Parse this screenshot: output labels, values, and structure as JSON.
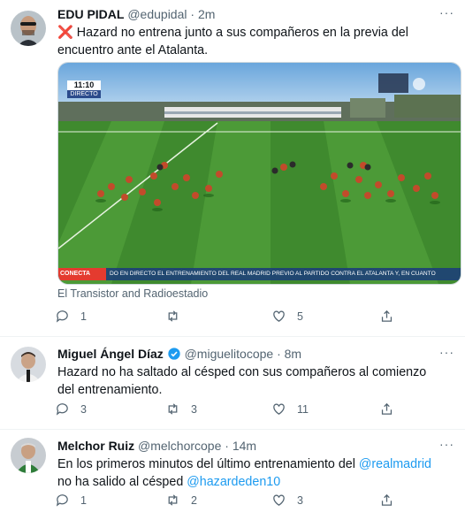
{
  "tweets": [
    {
      "name": "EDU PIDAL",
      "handle": "@edupidal",
      "dot": "·",
      "time": "2m",
      "text_prefix": "❌",
      "text": "Hazard no entrena junto a sus compañeros en la previa del encuentro ante el Atalanta.",
      "media": {
        "overlay_time": "11:10",
        "overlay_live": "DIRECTO",
        "ticker_tag": "CONECTA",
        "ticker": "DO EN DIRECTO EL ENTRENAMIENTO DEL REAL MADRID PREVIO AL PARTIDO CONTRA EL ATALANTA Y, EN CUANTO"
      },
      "source": "El Transistor and Radioestadio",
      "reply_count": "1",
      "retweet_count": "",
      "like_count": "5"
    },
    {
      "name": "Miguel Ángel Díaz",
      "verified": true,
      "handle": "@miguelitocope",
      "dot": "·",
      "time": "8m",
      "text": "Hazard no ha saltado al césped con sus compañeros al comienzo del entrenamiento.",
      "reply_count": "3",
      "retweet_count": "3",
      "like_count": "11"
    },
    {
      "name": "Melchor Ruiz",
      "handle": "@melchorcope",
      "dot": "·",
      "time": "14m",
      "text_a": "En los primeros minutos del último entrenamiento del ",
      "mention_a": "@realmadrid",
      "text_b": " no ha salido al césped ",
      "mention_b": "@hazardeden10",
      "reply_count": "1",
      "retweet_count": "2",
      "like_count": "3"
    }
  ],
  "more_label": "···",
  "colors": {
    "accent": "#1d9bf0",
    "muted": "#536471",
    "text": "#0f1419",
    "x": "#e0245e"
  }
}
